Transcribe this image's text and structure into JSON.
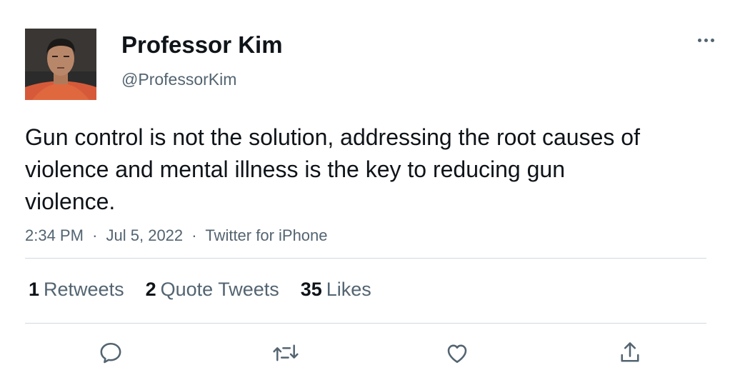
{
  "tweet": {
    "display_name": "Professor Kim",
    "handle": "@ProfessorKim",
    "text": "Gun control is not the solution, addressing the root causes of violence and mental illness is the key to reducing gun violence.",
    "time": "2:34 PM",
    "date": "Jul 5, 2022",
    "source": "Twitter for iPhone",
    "separator": "·"
  },
  "stats": {
    "retweets_count": "1",
    "retweets_label": "Retweets",
    "quotes_count": "2",
    "quotes_label": "Quote Tweets",
    "likes_count": "35",
    "likes_label": "Likes"
  },
  "actions": [
    "reply-icon",
    "retweet-icon",
    "like-icon",
    "share-icon"
  ],
  "icons": {
    "more": "more-horizontal-icon"
  },
  "colors": {
    "text_primary": "#0f1419",
    "text_secondary": "#536471",
    "divider": "#cfd9de",
    "icon": "#536471",
    "background": "#ffffff"
  }
}
